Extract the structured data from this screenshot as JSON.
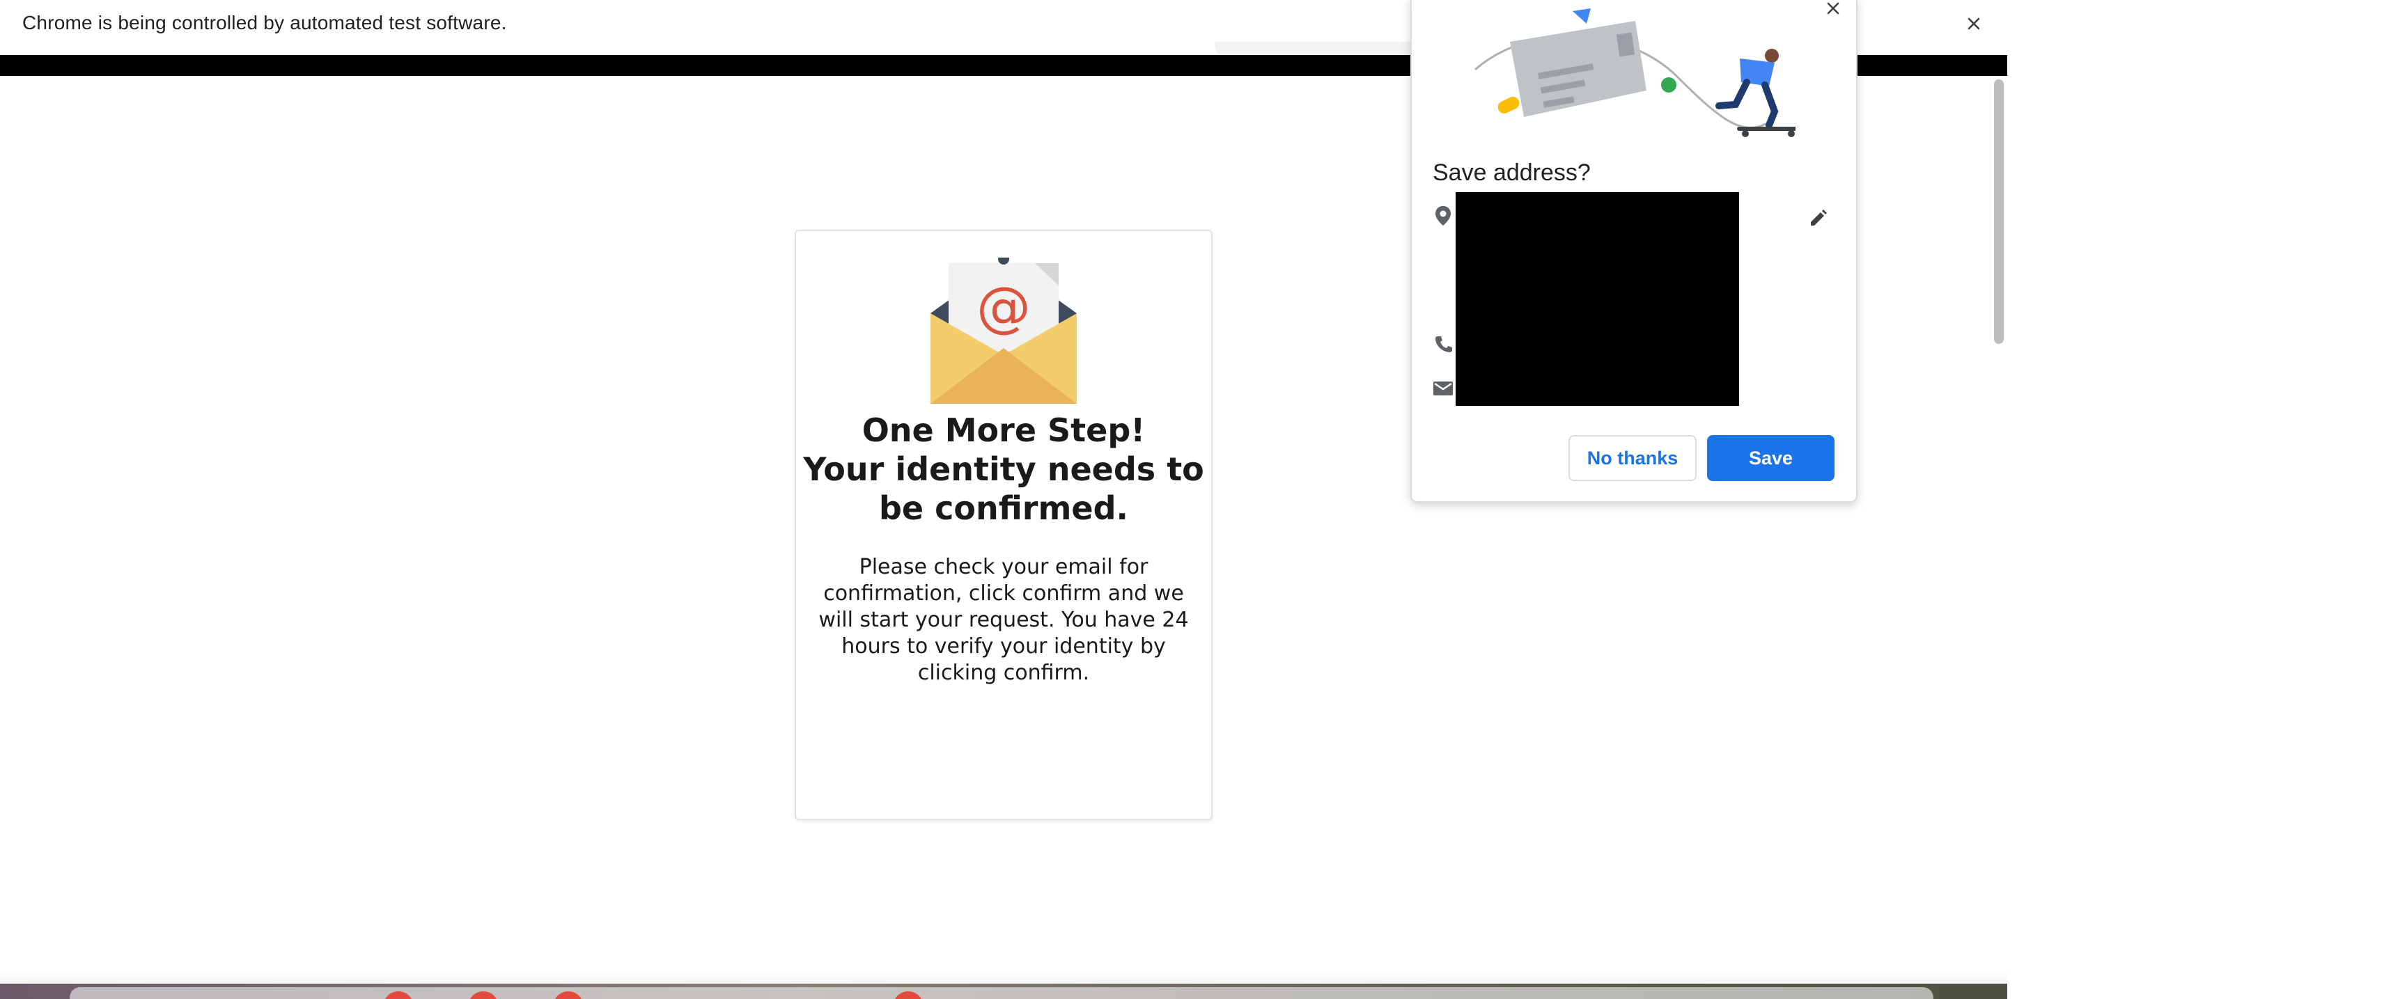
{
  "infobar": {
    "message": "Chrome is being controlled by automated test software.",
    "close_icon": "close-icon"
  },
  "page": {
    "icon": "email-envelope-icon",
    "heading_line1": "One More Step!",
    "heading_line2": "Your identity needs to be confirmed.",
    "body": "Please check your email for confirmation, click confirm and we will start your request. You have 24 hours to verify your identity by clicking confirm."
  },
  "save_address_bubble": {
    "title": "Save address?",
    "icons": [
      "location-pin-icon",
      "phone-icon",
      "mail-icon",
      "edit-pencil-icon",
      "close-icon"
    ],
    "secondary_button": "No thanks",
    "primary_button": "Save",
    "accent_color": "#1a73e8"
  }
}
